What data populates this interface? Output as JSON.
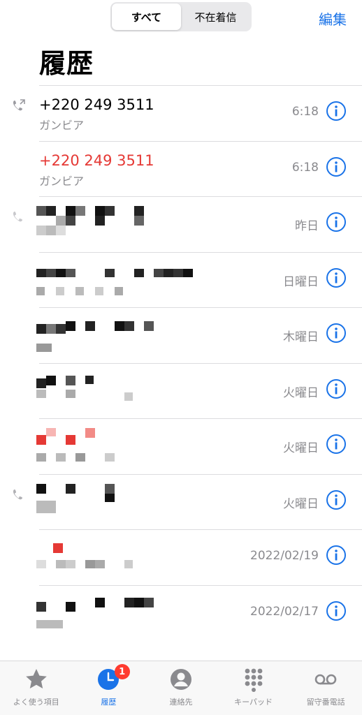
{
  "segments": [
    "すべて",
    "不在着信"
  ],
  "edit_label": "編集",
  "title": "履歴",
  "calls": [
    {
      "number": "+220 249 3511",
      "type": "ガンビア",
      "time": "6:18",
      "missed": false,
      "outgoing": true
    },
    {
      "number": "+220 249 3511",
      "type": "ガンビア",
      "time": "6:18",
      "missed": true,
      "outgoing": false
    },
    {
      "time": "昨日",
      "outgoing": true
    },
    {
      "time": "日曜日"
    },
    {
      "time": "木曜日"
    },
    {
      "time": "火曜日"
    },
    {
      "time": "火曜日",
      "missed": true
    },
    {
      "time": "火曜日",
      "outgoing": true
    },
    {
      "time": "2022/02/19",
      "missed": true
    },
    {
      "time": "2022/02/17"
    }
  ],
  "tabs": [
    {
      "label": "よく使う項目",
      "icon": "star-icon"
    },
    {
      "label": "履歴",
      "icon": "clock-icon",
      "badge": "1"
    },
    {
      "label": "連絡先",
      "icon": "person-icon"
    },
    {
      "label": "キーパッド",
      "icon": "keypad-icon"
    },
    {
      "label": "留守番電話",
      "icon": "voicemail-icon"
    }
  ],
  "colors": {
    "accent": "#1a73e8",
    "missed": "#e53935",
    "badge": "#ff3b30"
  }
}
